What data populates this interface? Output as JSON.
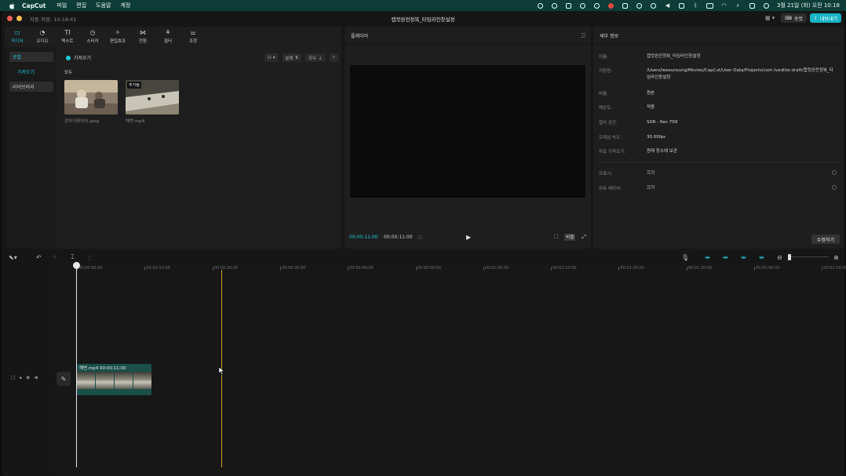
{
  "menubar": {
    "app_name": "CapCut",
    "items": [
      "파일",
      "편집",
      "도움말",
      "계정"
    ],
    "clock": "3월 21일 (화) 오전 10:18"
  },
  "window": {
    "autosave": "자동 저장: 10:18:41",
    "project_title": "캡컷완전정복_타임라인창설정",
    "shortcut_label": "숏컷",
    "export_label": "내보내기"
  },
  "media": {
    "tools": [
      {
        "label": "미디어",
        "icon": "media-icon"
      },
      {
        "label": "오디오",
        "icon": "audio-icon"
      },
      {
        "label": "텍스트",
        "icon": "text-icon"
      },
      {
        "label": "스티커",
        "icon": "sticker-icon"
      },
      {
        "label": "편집효과",
        "icon": "effects-icon"
      },
      {
        "label": "전환",
        "icon": "transition-icon"
      },
      {
        "label": "필터",
        "icon": "filter-icon"
      },
      {
        "label": "조정",
        "icon": "adjust-icon"
      }
    ],
    "sidebar": {
      "local": "로컬",
      "import": "가져오기",
      "library": "라이브러리"
    },
    "import_button": "가져오기",
    "sort_label": "분류",
    "all_filter": "모두",
    "all_heading": "모두",
    "files": [
      {
        "name": "강아지와아이.jpeg",
        "badge": ""
      },
      {
        "name": "해변.mp4",
        "badge": "추가됨"
      }
    ]
  },
  "player": {
    "title": "플레이어",
    "current_time": "00:00:11:00",
    "total_time": "00:00:11:00",
    "ratio_label": "비율"
  },
  "details": {
    "title": "세부 정보",
    "rows": [
      {
        "key": "이름:",
        "value": "캡컷완전정복_타임라인창설정"
      },
      {
        "key": "저장됨:",
        "value": "/Users/leeeunsung/Movies/CapCut/User Data/Projects/com.lveditor.draft/캡컷완전정복_타임라인창설정"
      },
      {
        "key": "비율:",
        "value": "원본"
      },
      {
        "key": "해상도:",
        "value": "적용"
      },
      {
        "key": "컬러 공간:",
        "value": "SDR - Rec.709"
      },
      {
        "key": "프레임 속도:",
        "value": "30.00fps"
      },
      {
        "key": "자료 가져오기:",
        "value": "원래 장소에 보관"
      },
      {
        "key": "프록시:",
        "value": "끄기"
      },
      {
        "key": "자유 레이어:",
        "value": "끄기"
      }
    ],
    "edit_button": "수정하기"
  },
  "timeline": {
    "ruler": [
      "00:00:00:00",
      "00:00:10:00",
      "00:00:20:00",
      "00:00:30:00",
      "00:00:40:00",
      "00:00:50:00",
      "00:01:00:00",
      "00:01:10:00",
      "00:01:20:00",
      "00:01:30:00",
      "00:01:40:00",
      "00:01:50:00"
    ],
    "clip_label": "해변.mp4  00:00:11:00"
  }
}
